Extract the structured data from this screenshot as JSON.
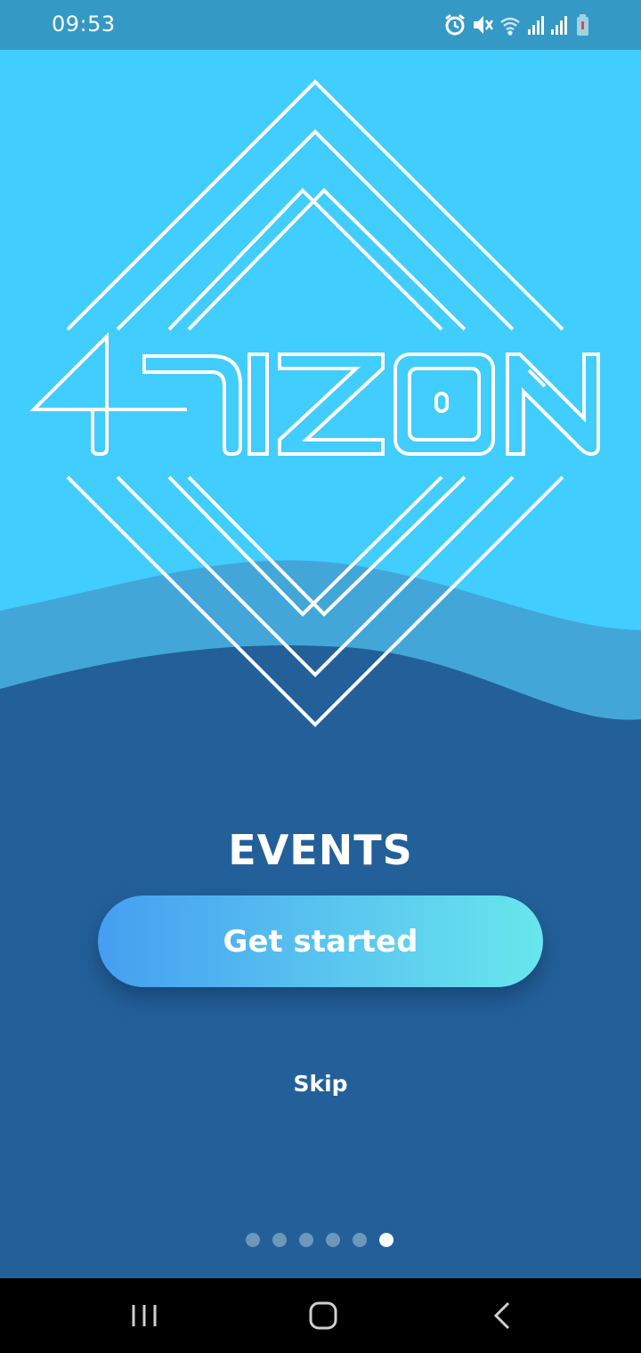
{
  "status_bar": {
    "time": "09:53",
    "icons": [
      "alarm-icon",
      "mute-icon",
      "wifi-icon",
      "signal-icon",
      "signal-icon",
      "battery-low-icon"
    ]
  },
  "logo": {
    "text": "ARIZON",
    "icon": "arizon-diamond-logo"
  },
  "onboarding": {
    "title": "EVENTS",
    "primary_button": "Get started",
    "secondary_link": "Skip",
    "page_count": 6,
    "current_page": 6
  },
  "nav_bar": {
    "buttons": [
      "recent-apps-icon",
      "home-icon",
      "back-icon"
    ]
  },
  "colors": {
    "sky": "#41cdfd",
    "wave_light": "#43a6d8",
    "wave_dark": "#236099",
    "status_bar": "#3499c4",
    "button_start": "#459ef0",
    "button_end": "#67e6ec"
  }
}
